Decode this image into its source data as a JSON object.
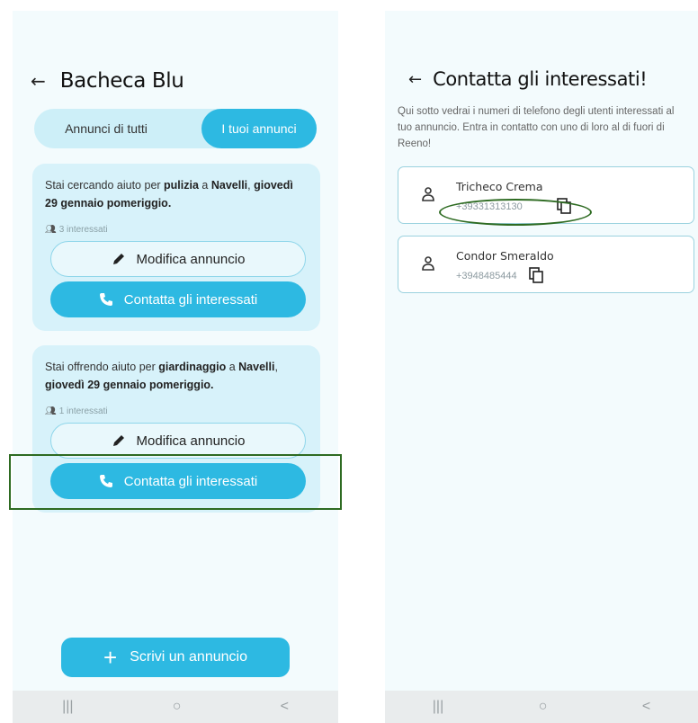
{
  "left": {
    "title": "Bacheca Blu",
    "tabs": {
      "all": "Annunci di tutti",
      "mine": "I tuoi annunci"
    },
    "cards": [
      {
        "pre": "Stai cercando aiuto per ",
        "service": "pulizia",
        "mid": " a ",
        "place": "Navelli",
        "sep": ", ",
        "when": "giovedì 29 gennaio pomeriggio.",
        "interested": "3 interessati",
        "edit_label": "Modifica annuncio",
        "contact_label": "Contatta gli interessati"
      },
      {
        "pre": "Stai offrendo aiuto per ",
        "service": "giardinaggio",
        "mid": " a ",
        "place": "Navelli",
        "sep": ", ",
        "when": "giovedì 29 gennaio pomeriggio.",
        "interested": "1 interessati",
        "edit_label": "Modifica annuncio",
        "contact_label": "Contatta gli interessati"
      }
    ],
    "fab_label": "Scrivi un annuncio"
  },
  "right": {
    "title": "Contatta gli interessati!",
    "description": "Qui sotto vedrai i numeri di telefono degli utenti interessati al tuo annuncio. Entra in contatto con uno di loro al di fuori di Reeno!",
    "contacts": [
      {
        "name": "Tricheco Crema",
        "phone": "+39331313130"
      },
      {
        "name": "Condor Smeraldo",
        "phone": "+3948485444"
      }
    ]
  },
  "navbar": {
    "recents": "|||",
    "home": "○",
    "back": "<"
  },
  "colors": {
    "accent": "#2db9e2",
    "card": "#d7f2fa",
    "highlight": "#2e6b22"
  }
}
